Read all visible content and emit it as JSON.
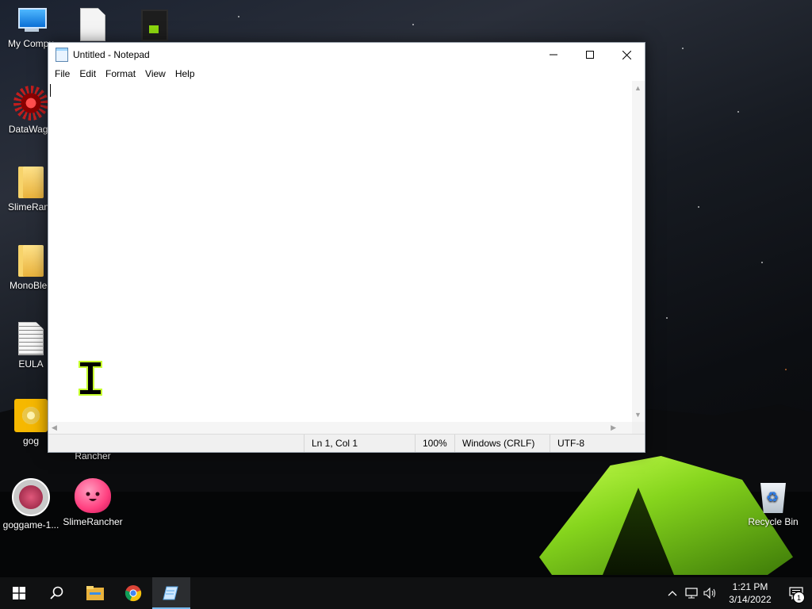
{
  "desktop": {
    "icons": [
      {
        "label": "My Compu"
      },
      {
        "label": ""
      },
      {
        "label": ""
      },
      {
        "label": "DataWago"
      },
      {
        "label": "SlimeRanc"
      },
      {
        "label": "MonoBlee"
      },
      {
        "label": "EULA"
      },
      {
        "label": "gog"
      },
      {
        "label": "Rancher"
      },
      {
        "label": "goggame-1..."
      },
      {
        "label": "SlimeRancher"
      },
      {
        "label": "Recycle Bin"
      }
    ]
  },
  "window": {
    "title": "Untitled - Notepad",
    "buttons": {
      "minimize": "—",
      "maximize": "☐",
      "close": "✕"
    },
    "menu": [
      "File",
      "Edit",
      "Format",
      "View",
      "Help"
    ],
    "editor_text": "",
    "status": {
      "position": "Ln 1, Col 1",
      "zoom": "100%",
      "line_ending": "Windows (CRLF)",
      "encoding": "UTF-8"
    }
  },
  "taskbar": {
    "apps": [
      "start-icon",
      "search-icon",
      "file-explorer-icon",
      "chrome-icon",
      "notepad-icon"
    ],
    "clock": {
      "time": "1:21 PM",
      "date": "3/14/2022"
    },
    "notification_count": "1"
  }
}
